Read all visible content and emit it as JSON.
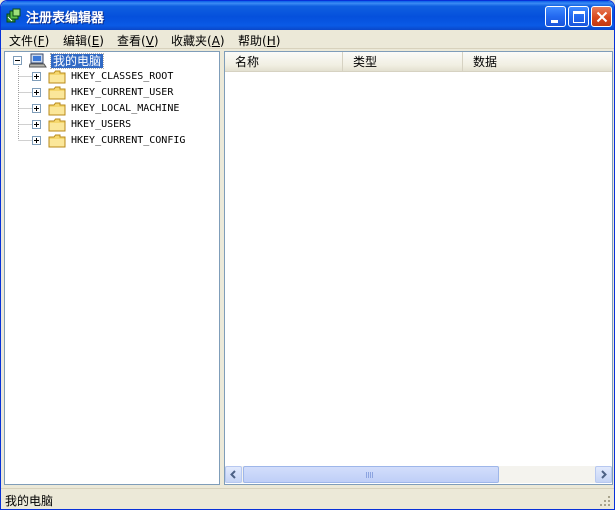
{
  "window": {
    "title": "注册表编辑器",
    "controls": {
      "minimize": "minimize",
      "maximize": "maximize",
      "close": "close"
    }
  },
  "menu": [
    {
      "label": "文件",
      "accel": "F"
    },
    {
      "label": "编辑",
      "accel": "E"
    },
    {
      "label": "查看",
      "accel": "V"
    },
    {
      "label": "收藏夹",
      "accel": "A"
    },
    {
      "label": "帮助",
      "accel": "H"
    }
  ],
  "tree": {
    "root": {
      "label": "我的电脑",
      "icon": "computer-icon",
      "expanded": true,
      "selected": true
    },
    "keys": [
      {
        "label": "HKEY_CLASSES_ROOT",
        "icon": "folder-icon"
      },
      {
        "label": "HKEY_CURRENT_USER",
        "icon": "folder-icon"
      },
      {
        "label": "HKEY_LOCAL_MACHINE",
        "icon": "folder-icon"
      },
      {
        "label": "HKEY_USERS",
        "icon": "folder-icon"
      },
      {
        "label": "HKEY_CURRENT_CONFIG",
        "icon": "folder-icon"
      }
    ]
  },
  "list": {
    "columns": [
      "名称",
      "类型",
      "数据"
    ],
    "rows": []
  },
  "status": {
    "text": "我的电脑"
  },
  "colors": {
    "titlebar": "#0550dc",
    "selection": "#316ac5",
    "close_button": "#d9481c",
    "folder": "#f5d76e"
  }
}
